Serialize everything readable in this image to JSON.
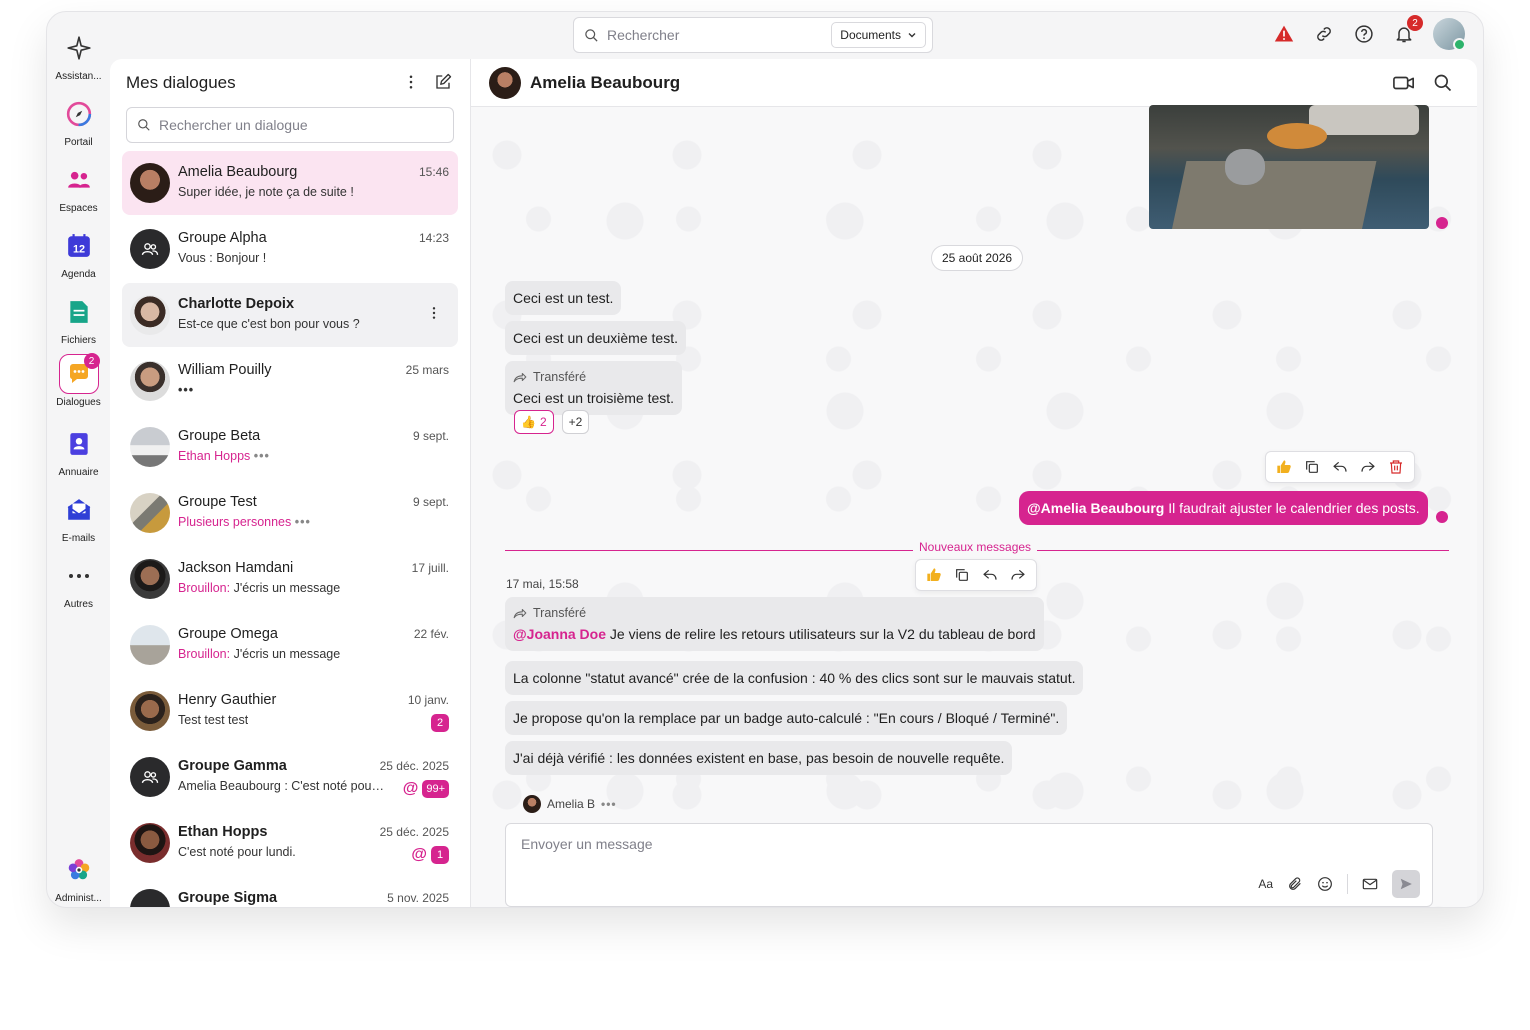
{
  "colors": {
    "accent": "#d6248f",
    "danger": "#d62a2a",
    "bubble": "#e9e9eb",
    "selected_row": "#fbe4f1"
  },
  "rail": {
    "items": [
      {
        "label": "Assistan...",
        "icon": "sparkle-icon"
      },
      {
        "label": "Portail",
        "icon": "compass-icon"
      },
      {
        "label": "Espaces",
        "icon": "users-icon"
      },
      {
        "label": "Agenda",
        "icon": "calendar-icon",
        "day": "12"
      },
      {
        "label": "Fichiers",
        "icon": "file-icon"
      },
      {
        "label": "Dialogues",
        "icon": "chat-icon",
        "badge": "2"
      },
      {
        "label": "Annuaire",
        "icon": "contact-book-icon"
      },
      {
        "label": "E-mails",
        "icon": "mail-icon"
      },
      {
        "label": "Autres",
        "icon": "more-icon"
      },
      {
        "label": "Administ...",
        "icon": "admin-flower-icon"
      }
    ]
  },
  "topbar": {
    "search_placeholder": "Rechercher",
    "scope": "Documents",
    "notifications_count": "2"
  },
  "dialogs": {
    "title": "Mes dialogues",
    "search_placeholder": "Rechercher un dialogue",
    "items": [
      {
        "name": "Amelia Beaubourg",
        "time": "15:46",
        "sub": "Super idée, je note ça de suite !"
      },
      {
        "name": "Groupe Alpha",
        "time": "14:23",
        "sub": "Vous : Bonjour !"
      },
      {
        "name": "Charlotte Depoix",
        "sub": "Est-ce que c'est bon pour vous ?"
      },
      {
        "name": "William Pouilly",
        "time": "25 mars",
        "sub": "•••"
      },
      {
        "name": "Groupe Beta",
        "time": "9 sept.",
        "sub_prefix": "Ethan Hopps",
        "sub": "•••"
      },
      {
        "name": "Groupe Test",
        "time": "9 sept.",
        "sub_prefix": "Plusieurs personnes",
        "sub": "•••"
      },
      {
        "name": "Jackson Hamdani",
        "time": "17 juill.",
        "sub_prefix": "Brouillon:",
        "sub": "J'écris un message"
      },
      {
        "name": "Groupe Omega",
        "time": "22 fév.",
        "sub_prefix": "Brouillon:",
        "sub": "J'écris un message"
      },
      {
        "name": "Henry Gauthier",
        "time": "10 janv.",
        "sub": "Test test test",
        "count": "2"
      },
      {
        "name": "Groupe Gamma",
        "time": "25 déc. 2025",
        "sub": "Amelia Beaubourg : C'est noté pour...",
        "at": "@",
        "count": "99+"
      },
      {
        "name": "Ethan Hopps",
        "time": "25 déc. 2025",
        "sub": "C'est noté pour lundi.",
        "at": "@",
        "count": "1"
      },
      {
        "name": "Groupe Sigma",
        "time": "5 nov. 2025"
      }
    ]
  },
  "chat": {
    "contact": "Amelia Beaubourg",
    "date_separator": "25 août 2026",
    "messages_in_1": [
      "Ceci est un test.",
      "Ceci est un deuxième test."
    ],
    "forwarded_label": "Transféré",
    "msg3": "Ceci est un troisième test.",
    "reaction_emoji": "👍",
    "reaction_count": "2",
    "reaction_more": "+2",
    "mine_mention": "@Amelia Beaubourg",
    "mine_text": " Il faudrait ajuster le calendrier des posts.",
    "new_messages": "Nouveaux messages",
    "timestamp": "17 mai, 15:58",
    "fwd_mention": "@Joanna Doe",
    "fwd_text": " Je viens de relire les retours utilisateurs sur la V2 du tableau de bord",
    "msg_a": "La colonne \"statut avancé\" crée de la confusion : 40 % des clics sont sur le mauvais statut.",
    "msg_b": "Je propose qu'on la remplace par un badge auto-calculé : \"En cours / Bloqué / Terminé\".",
    "msg_c": "J'ai déjà vérifié : les données existent en base, pas besoin de nouvelle requête.",
    "typing_name": "Amelia B",
    "typing_dots": "•••",
    "composer_placeholder": "Envoyer un message",
    "format_label": "Aa"
  }
}
